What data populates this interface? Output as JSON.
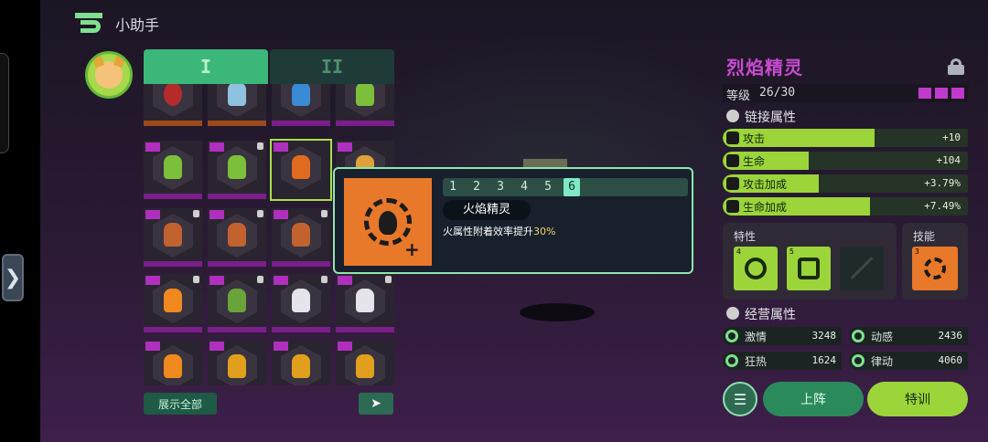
{
  "header": {
    "title": "小助手"
  },
  "tabs": [
    {
      "label": "I"
    },
    {
      "label": "II"
    }
  ],
  "grid": {
    "show_all_label": "展示全部",
    "sort_icon": "cursor-sort-icon"
  },
  "popup": {
    "levels": [
      "1",
      "2",
      "3",
      "4",
      "5",
      "6"
    ],
    "current_level": "6",
    "name": "火焰精灵",
    "desc_prefix": "火属性附着效率提升",
    "desc_value": "30%"
  },
  "hero": {
    "name": "烈焰精灵",
    "level_label": "等级",
    "level_value": "26/30",
    "star_color": "#c23acd",
    "combat_title": "链接属性",
    "stats": [
      {
        "label": "攻击",
        "value": "+10",
        "fill": 0.62
      },
      {
        "label": "生命",
        "value": "+104",
        "fill": 0.35
      },
      {
        "label": "攻击加成",
        "value": "+3.79%",
        "fill": 0.39
      },
      {
        "label": "生命加成",
        "value": "+7.49%",
        "fill": 0.6
      }
    ],
    "traits_title": "特性",
    "traits": [
      {
        "num": "4"
      },
      {
        "num": "5"
      },
      {
        "num": ""
      }
    ],
    "skills_title": "技能",
    "skill": {
      "num": "3"
    },
    "business_title": "经营属性",
    "business": [
      {
        "label": "激情",
        "value": "3248"
      },
      {
        "label": "动感",
        "value": "2436"
      },
      {
        "label": "狂热",
        "value": "1624"
      },
      {
        "label": "律动",
        "value": "4060"
      }
    ],
    "deploy_label": "上阵",
    "train_label": "特训"
  },
  "colors": {
    "accent_green": "#9bd53a",
    "accent_purple": "#c84ad0",
    "popup_orange": "#e8782a"
  }
}
